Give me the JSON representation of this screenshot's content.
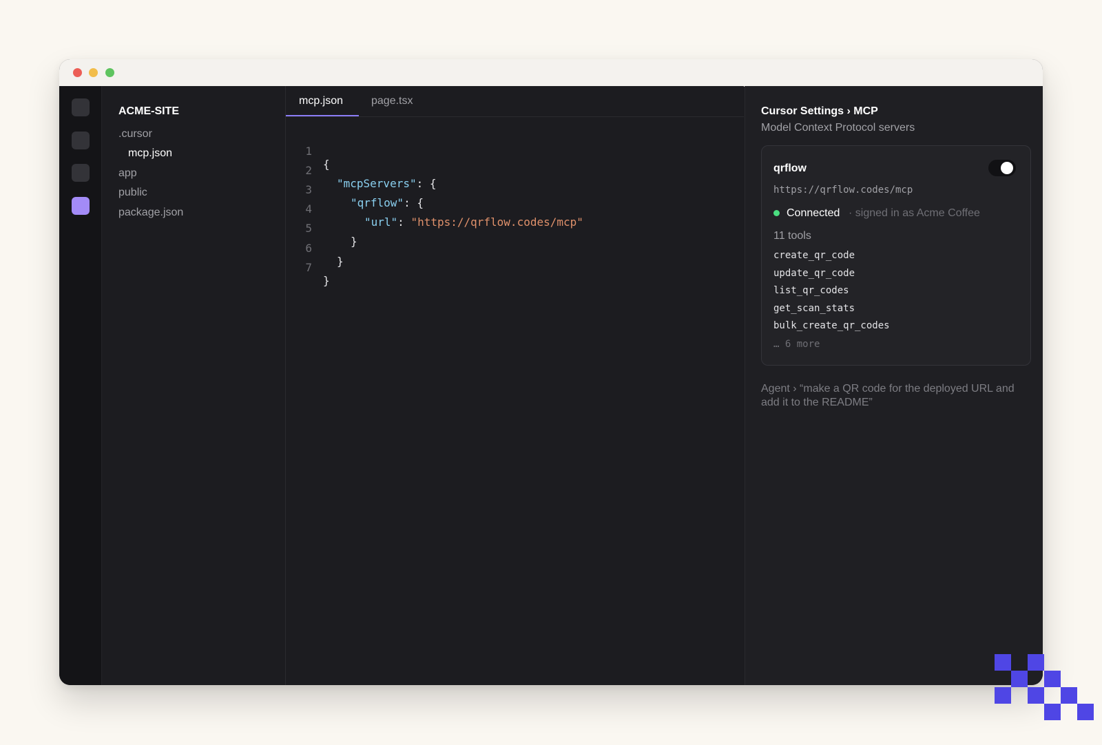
{
  "explorer": {
    "project": "ACME-SITE",
    "items": [
      ".cursor",
      "mcp.json",
      "app",
      "public",
      "package.json"
    ]
  },
  "editor": {
    "tabs": [
      "mcp.json",
      "page.tsx"
    ],
    "line_numbers": [
      "1",
      "2",
      "3",
      "4",
      "5",
      "6",
      "7"
    ],
    "code": {
      "l1": "{",
      "l2_key": "\"mcpServers\"",
      "l2_rest": ": {",
      "l3_key": "\"qrflow\"",
      "l3_rest": ": {",
      "l4_key": "\"url\"",
      "l4_colon": ": ",
      "l4_value": "\"https://qrflow.codes/mcp\"",
      "l5": "}",
      "l6": "}",
      "l7": "}"
    }
  },
  "panel": {
    "title": "Cursor Settings › MCP",
    "subtitle": "Model Context Protocol servers",
    "server": {
      "name": "qrflow",
      "enabled": true,
      "url": "https://qrflow.codes/mcp",
      "status": "Connected",
      "status_detail": "· signed in as Acme Coffee",
      "tools_count": "11 tools",
      "tools": [
        "create_qr_code",
        "update_qr_code",
        "list_qr_codes",
        "get_scan_stats",
        "bulk_create_qr_codes"
      ],
      "more": "… 6 more"
    },
    "agent_prompt": "Agent › “make a QR code for the deployed URL and add it to the README”"
  },
  "colors": {
    "accent": "#8b7cf6",
    "connected": "#4ade80",
    "logo": "#4f46e5"
  }
}
